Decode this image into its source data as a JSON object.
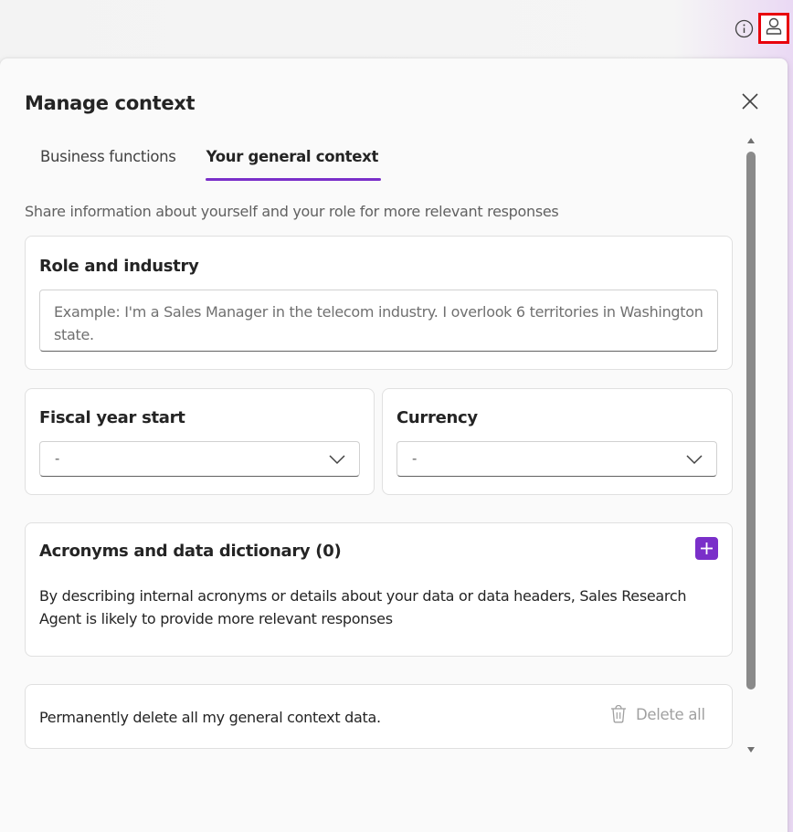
{
  "topbar": {
    "info_icon": "info-icon",
    "profile_icon": "person-icon"
  },
  "panel": {
    "title": "Manage context",
    "close_icon": "close-icon",
    "tabs": [
      {
        "label": "Business functions",
        "active": false
      },
      {
        "label": "Your general context",
        "active": true
      }
    ],
    "subtitle": "Share information about yourself and your role for more relevant responses",
    "role": {
      "title": "Role and industry",
      "value": "",
      "placeholder": "Example: I'm a Sales Manager in the telecom industry. I overlook 6 territories in Washington state."
    },
    "fiscal": {
      "title": "Fiscal year start",
      "selected": "-"
    },
    "currency": {
      "title": "Currency",
      "selected": "-"
    },
    "acronyms": {
      "title": "Acronyms and data dictionary (0)",
      "description": "By describing internal acronyms or details about your data or data headers, Sales Research Agent is likely to provide more relevant responses",
      "add_icon": "plus-icon"
    },
    "delete": {
      "text": "Permanently delete all my general context data.",
      "button_label": "Delete all",
      "icon": "trash-icon"
    }
  },
  "colors": {
    "accent": "#7a2fc9",
    "highlight_border": "#e8000b"
  }
}
